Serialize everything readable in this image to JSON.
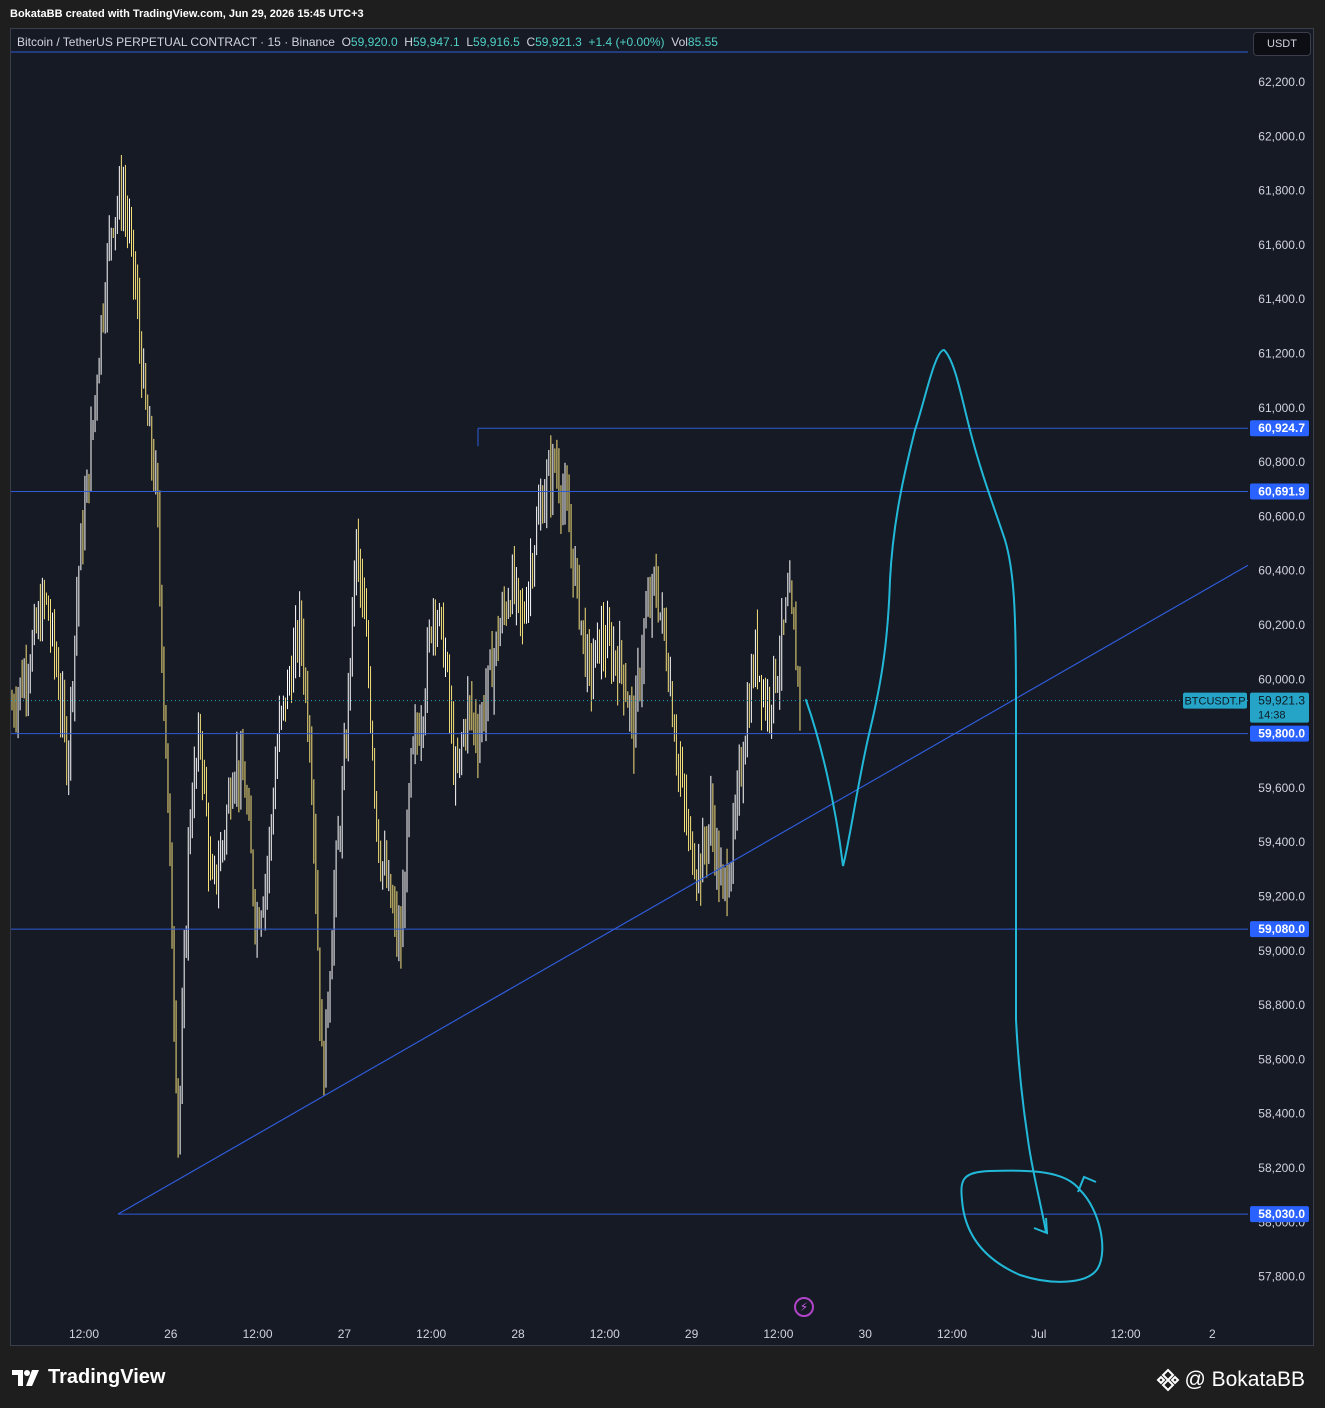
{
  "header": {
    "creator_line": "BokataBB created with TradingView.com, Jun 29, 2026 15:45 UTC+3"
  },
  "legend": {
    "symbol_desc": "Bitcoin / TetherUS PERPETUAL CONTRACT · 15 · Binance",
    "o_label": "O",
    "o_value": "59,920.0",
    "h_label": "H",
    "h_value": "59,947.1",
    "l_label": "L",
    "l_value": "59,916.5",
    "c_label": "C",
    "c_value": "59,921.3",
    "change": "+1.4 (+0.00%)",
    "vol_label": "Vol",
    "vol_value": "85.55"
  },
  "currency_button": "USDT",
  "footer": {
    "brand": "TradingView",
    "handle": "@ BokataBB"
  },
  "colors": {
    "background": "#161a25",
    "candle_up": "#ffffff",
    "candle_down": "#f5e07a",
    "hline": "#2f5bd8",
    "drawing": "#22b8d8",
    "price_label": "#2962ff",
    "current_price": "#26a4c8"
  },
  "chart_data": {
    "type": "candlestick",
    "symbol": "BTCUSDT.P",
    "timeframe": "15",
    "y_ticks": [
      "62,200.0",
      "62,000.0",
      "61,800.0",
      "61,600.0",
      "61,400.0",
      "61,200.0",
      "61,000.0",
      "60,800.0",
      "60,600.0",
      "60,400.0",
      "60,200.0",
      "60,000.0",
      "59,800.0",
      "59,600.0",
      "59,400.0",
      "59,200.0",
      "59,000.0",
      "58,800.0",
      "58,600.0",
      "58,400.0",
      "58,200.0",
      "58,000.0",
      "57,800.0"
    ],
    "y_tick_values": [
      62200,
      62000,
      61800,
      61600,
      61400,
      61200,
      61000,
      60800,
      60600,
      60400,
      60200,
      60000,
      59800,
      59600,
      59400,
      59200,
      59000,
      58800,
      58600,
      58400,
      58200,
      58000,
      57800
    ],
    "x_ticks": [
      "12:00",
      "26",
      "12:00",
      "27",
      "12:00",
      "28",
      "12:00",
      "29",
      "12:00",
      "30",
      "12:00",
      "Jul",
      "12:00",
      "2"
    ],
    "horizontal_levels": [
      {
        "label": "60,924.7",
        "value": 60924.7
      },
      {
        "label": "60,691.9",
        "value": 60691.9
      },
      {
        "label": "59,800.0",
        "value": 59800.0
      },
      {
        "label": "59,080.0",
        "value": 59080.0
      },
      {
        "label": "58,030.0",
        "value": 58030.0
      }
    ],
    "current_price": {
      "symbol_label": "BTCUSDT.P",
      "price": "59,921.3",
      "countdown": "14:38",
      "value": 59921.3
    },
    "trendline": {
      "from_price": 58030,
      "to_price": 60420
    },
    "price_path": [
      59900,
      60000,
      60150,
      60300,
      60050,
      59700,
      60400,
      60800,
      61300,
      61700,
      61800,
      61500,
      61000,
      60700,
      59600,
      58300,
      59500,
      59800,
      59200,
      59400,
      59700,
      59600,
      59100,
      59300,
      59800,
      60000,
      60200,
      59700,
      58500,
      59200,
      59700,
      60500,
      60100,
      59400,
      59200,
      59000,
      59700,
      59900,
      60300,
      60100,
      59600,
      59900,
      59800,
      60000,
      60200,
      60350,
      60200,
      60500,
      60700,
      60800,
      60600,
      60300,
      60000,
      60150,
      60100,
      60050,
      59800,
      60200,
      60350,
      60100,
      59700,
      59400,
      59300,
      59500,
      59200,
      59400,
      59800,
      60100,
      59900,
      60050,
      60300,
      59950
    ]
  }
}
